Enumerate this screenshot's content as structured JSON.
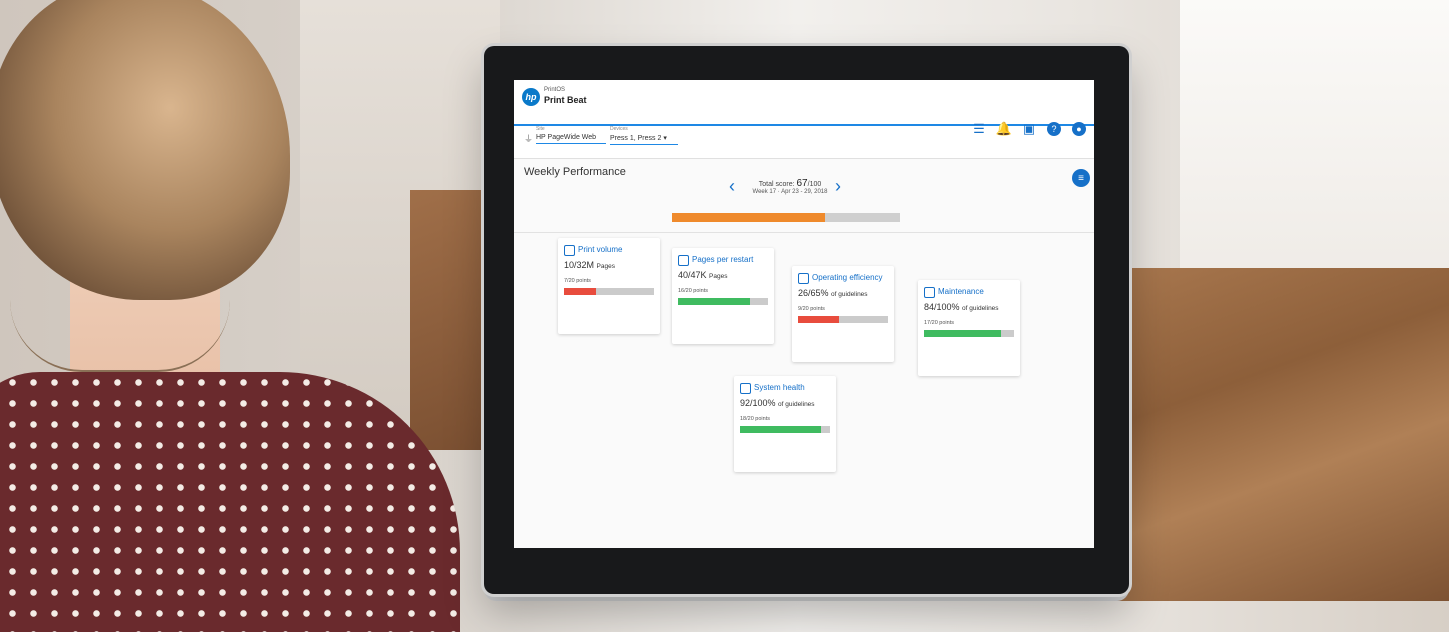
{
  "app": {
    "suite": "PrintOS",
    "title": "Print Beat",
    "logo_text": "hp"
  },
  "filters": {
    "site": {
      "label": "Site",
      "value": "HP PageWide Web"
    },
    "devices": {
      "label": "Devices",
      "value": "Press 1, Press 2"
    }
  },
  "page": {
    "title": "Weekly Performance",
    "score_label": "Total score:",
    "score_value": "67",
    "score_max": "/100",
    "week": "Week 17 · Apr 23 - 29, 2018",
    "score_fraction": 0.67
  },
  "nav_icons": [
    "list-icon",
    "bell-icon",
    "chat-icon",
    "help-icon",
    "user-icon"
  ],
  "cards": [
    {
      "title": "Print volume",
      "value": "10/32M",
      "unit": "Pages",
      "points": "7/20 points",
      "fraction": 0.35,
      "status": "red"
    },
    {
      "title": "Pages per restart",
      "value": "40/47K",
      "unit": "Pages",
      "points": "16/20 points",
      "fraction": 0.8,
      "status": "green"
    },
    {
      "title": "Operating efficiency",
      "value": "26/65%",
      "unit": "of guidelines",
      "points": "9/20 points",
      "fraction": 0.45,
      "status": "red"
    },
    {
      "title": "Maintenance",
      "value": "84/100%",
      "unit": "of guidelines",
      "points": "17/20 points",
      "fraction": 0.85,
      "status": "green"
    },
    {
      "title": "System health",
      "value": "92/100%",
      "unit": "of guidelines",
      "points": "18/20 points",
      "fraction": 0.9,
      "status": "green"
    }
  ],
  "colors": {
    "brand": "#1670c8",
    "score": "#ef8a2c",
    "good": "#3fbb60",
    "bad": "#e84c3d"
  }
}
